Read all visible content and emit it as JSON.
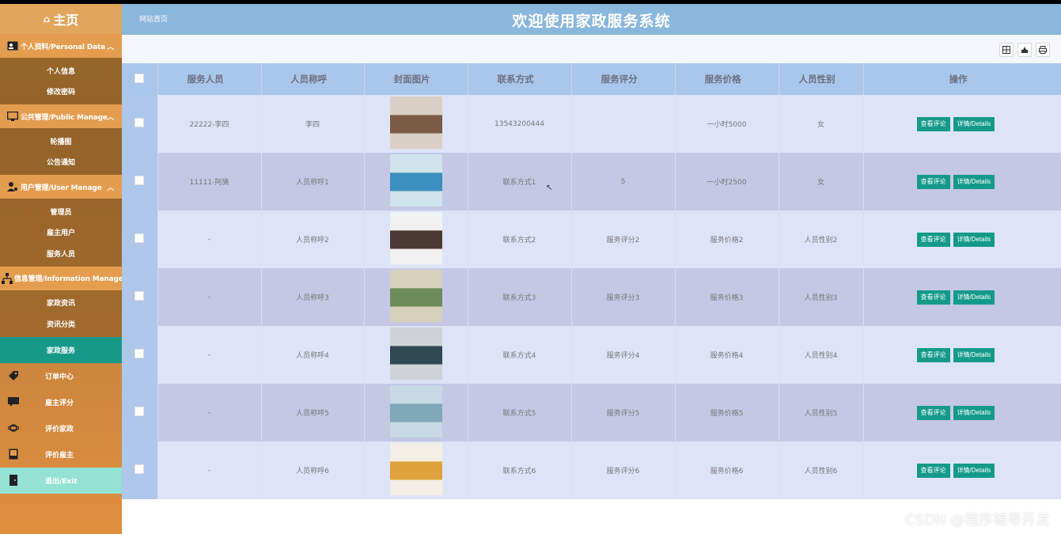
{
  "sidebar": {
    "title": "主页",
    "sections": [
      {
        "label": "个人资料/Personal Data",
        "items": [
          "个人信息",
          "修改密码"
        ]
      },
      {
        "label": "公共管理/Public Manage",
        "items": [
          "轮播图",
          "公告通知"
        ]
      },
      {
        "label": "用户管理/User Manage",
        "items": [
          "管理员",
          "雇主用户",
          "服务人员"
        ]
      },
      {
        "label": "信息管理/Information Manage",
        "items": [
          "家政资讯",
          "资讯分类"
        ]
      }
    ],
    "active_item": "家政服务",
    "menu": [
      "订单中心",
      "雇主评分",
      "评价家政",
      "评价雇主"
    ],
    "exit": "退出/Exit"
  },
  "header": {
    "home_link": "网站首页",
    "title": "欢迎使用家政服务系统"
  },
  "table": {
    "columns": [
      "服务人员",
      "人员称呼",
      "封面图片",
      "联系方式",
      "服务评分",
      "服务价格",
      "人员性别",
      "操作"
    ],
    "rows": [
      {
        "staff": "22222-李四",
        "name": "李四",
        "contact": "13543200444",
        "score": "",
        "price": "一小时5000",
        "gender": "女"
      },
      {
        "staff": "11111-阿旖",
        "name": "人员称呼1",
        "contact": "联系方式1",
        "score": "5",
        "price": "一小时2500",
        "gender": "女"
      },
      {
        "staff": "-",
        "name": "人员称呼2",
        "contact": "联系方式2",
        "score": "服务评分2",
        "price": "服务价格2",
        "gender": "人员性别2"
      },
      {
        "staff": "-",
        "name": "人员称呼3",
        "contact": "联系方式3",
        "score": "服务评分3",
        "price": "服务价格3",
        "gender": "人员性别3"
      },
      {
        "staff": "-",
        "name": "人员称呼4",
        "contact": "联系方式4",
        "score": "服务评分4",
        "price": "服务价格4",
        "gender": "人员性别4"
      },
      {
        "staff": "-",
        "name": "人员称呼5",
        "contact": "联系方式5",
        "score": "服务评分5",
        "price": "服务价格5",
        "gender": "人员性别5"
      },
      {
        "staff": "-",
        "name": "人员称呼6",
        "contact": "联系方式6",
        "score": "服务评分6",
        "price": "服务价格6",
        "gender": "人员性别6"
      }
    ],
    "view_rating_label": "查看评论",
    "details_label": "详情/Details"
  },
  "watermark": "CSDN @程序辅导开发",
  "colors": {
    "accent": "#17998a",
    "header": "#8ab7dc",
    "sidebar": "#e49d4f"
  }
}
